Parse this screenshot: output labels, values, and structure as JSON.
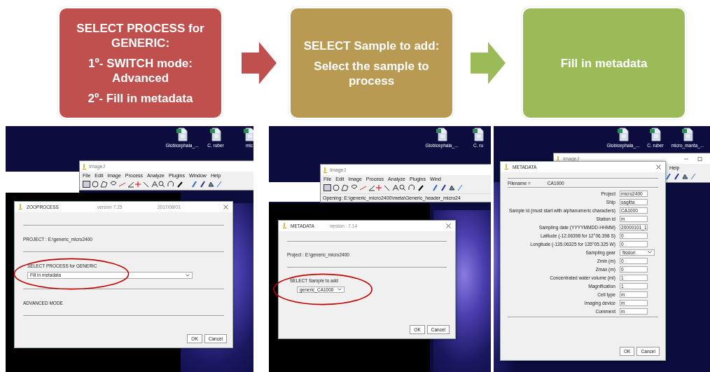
{
  "steps": [
    {
      "color": "#c0504d",
      "lines": [
        "SELECT PROCESS for GENERIC:",
        "1º- SWITCH mode: Advanced",
        "2º- Fill in metadata"
      ]
    },
    {
      "color": "#b99a52",
      "lines": [
        "SELECT Sample to add:",
        "Select the sample to process"
      ]
    },
    {
      "color": "#9bbb59",
      "lines": [
        "Fill in metadata"
      ]
    }
  ],
  "arrows": [
    {
      "color": "#c0504d"
    },
    {
      "color": "#9bbb59"
    }
  ],
  "panels": [
    {
      "desktop_icons": [
        "Globicephala_...",
        "C. ruber",
        "mic"
      ],
      "imagej": {
        "title": "ImageJ",
        "menu": [
          "File",
          "Edit",
          "Image",
          "Process",
          "Analyze",
          "Plugins",
          "Window",
          "Help"
        ]
      },
      "dialog": {
        "title": "ZOOPROCESS",
        "version": "version 7.25",
        "date": "2017/08/03",
        "rows": [
          {
            "kind": "rule"
          },
          {
            "kind": "text",
            "text": "PROJECT : E:\\generic_micro2400"
          },
          {
            "kind": "rule"
          },
          {
            "kind": "choice",
            "label": "SELECT PROCESS for GENERIC",
            "value": "Fill in metadata",
            "circled": true,
            "full_width": true
          },
          {
            "kind": "rule"
          },
          {
            "kind": "text",
            "text": "ADVANCED MODE"
          },
          {
            "kind": "rule"
          }
        ],
        "buttons": [
          "OK",
          "Cancel"
        ]
      }
    },
    {
      "desktop_icons": [
        "Globicephala_...",
        "C. ru"
      ],
      "imagej": {
        "title": "ImageJ",
        "menu": [
          "File",
          "Edit",
          "Image",
          "Process",
          "Analyze",
          "Plugins",
          "Wind"
        ],
        "status": "Opening: E:\\generic_micro2400\\meta\\Generic_header_micro24"
      },
      "dialog": {
        "title": "METADATA",
        "version": "version : 7.14",
        "rows": [
          {
            "kind": "rule"
          },
          {
            "kind": "text",
            "text": "Project :  E:\\generic_micro2400"
          },
          {
            "kind": "rule"
          },
          {
            "kind": "choice",
            "label": "SELECT Sample to add",
            "value": "generic_CA1000",
            "circled": true,
            "full_width": false
          }
        ],
        "buttons": [
          "OK",
          "Cancel"
        ]
      }
    },
    {
      "desktop_icons": [
        "Globicephala_...",
        "C. ruber",
        "micro_manta_..."
      ],
      "imagej": {
        "title": "ImageJ",
        "menu": [
          "Help"
        ],
        "window_controls": true
      },
      "dialog": {
        "title": "METADATA",
        "rows": [
          {
            "kind": "rule"
          },
          {
            "kind": "info",
            "label": "Filename =",
            "value": "CA1000"
          },
          {
            "kind": "rule"
          },
          {
            "kind": "field",
            "label": "Project",
            "value": "micro2400"
          },
          {
            "kind": "field",
            "label": "Ship",
            "value": "sagitta"
          },
          {
            "kind": "field",
            "label": "Sample id (must start with alphanumeric characters)",
            "value": "CA1000"
          },
          {
            "kind": "field",
            "label": "Station id",
            "value": "m"
          },
          {
            "kind": "field",
            "label": "Sampling date (YYYYMMDD-HHMM)",
            "value": "20000101_1"
          },
          {
            "kind": "field",
            "label": "Latitude  (-12.06398 for 12°06.398 S)",
            "value": "0"
          },
          {
            "kind": "field",
            "label": "Longitude (-135.06325 for 135°05.325 W)",
            "value": "0"
          },
          {
            "kind": "select",
            "label": "Sampling gear",
            "value": "fission"
          },
          {
            "kind": "field",
            "label": "Zmin (m)",
            "value": "0"
          },
          {
            "kind": "field",
            "label": "Zmax (m)",
            "value": "0"
          },
          {
            "kind": "field",
            "label": "Concentrated water volume (ml)",
            "value": "1"
          },
          {
            "kind": "field",
            "label": "Magnification",
            "value": "1"
          },
          {
            "kind": "field",
            "label": "Cell type",
            "value": "m"
          },
          {
            "kind": "field",
            "label": "Imaging device",
            "value": "m"
          },
          {
            "kind": "field",
            "label": "Comment",
            "value": "m"
          },
          {
            "kind": "rule"
          }
        ],
        "buttons": [
          "OK",
          "Cancel"
        ]
      }
    }
  ]
}
